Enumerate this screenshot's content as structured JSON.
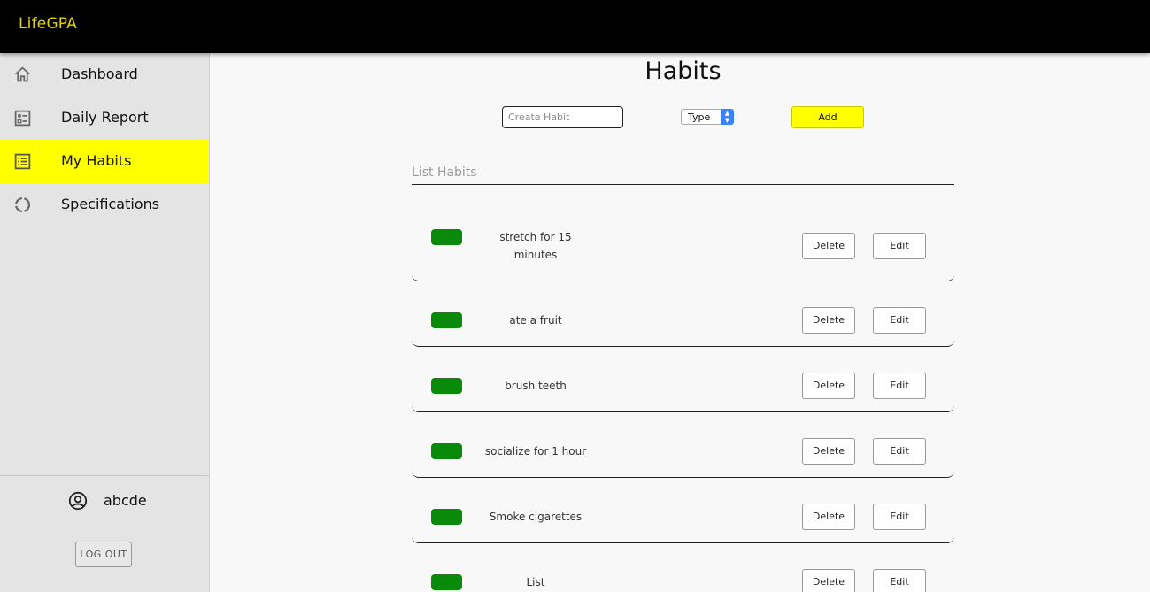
{
  "app": {
    "brand": "LifeGPA",
    "brand_color": "#e6d400"
  },
  "sidebar": {
    "items": [
      {
        "label": "Dashboard",
        "icon": "home-icon",
        "active": false
      },
      {
        "label": "Daily Report",
        "icon": "report-icon",
        "active": false
      },
      {
        "label": "My Habits",
        "icon": "list-icon",
        "active": true
      },
      {
        "label": "Specifications",
        "icon": "loading-circle-icon",
        "active": false
      }
    ],
    "user": {
      "name": "abcde",
      "icon": "user-circle-icon"
    },
    "logout_label": "LOG OUT",
    "active_color": "#ffff00"
  },
  "main": {
    "title": "Habits",
    "create": {
      "placeholder": "Create Habit",
      "value": ""
    },
    "type_select": {
      "selected": "Type"
    },
    "add_label": "Add",
    "list_heading": "List Habits",
    "delete_label": "Delete",
    "edit_label": "Edit",
    "habits": [
      {
        "name": "stretch for 15 minutes",
        "color": "#0a8a0a"
      },
      {
        "name": "ate a fruit",
        "color": "#0a8a0a"
      },
      {
        "name": "brush teeth",
        "color": "#0a8a0a"
      },
      {
        "name": "socialize for 1 hour",
        "color": "#0a8a0a"
      },
      {
        "name": "Smoke cigarettes",
        "color": "#0a8a0a"
      },
      {
        "name": "List",
        "color": "#0a8a0a"
      }
    ]
  }
}
